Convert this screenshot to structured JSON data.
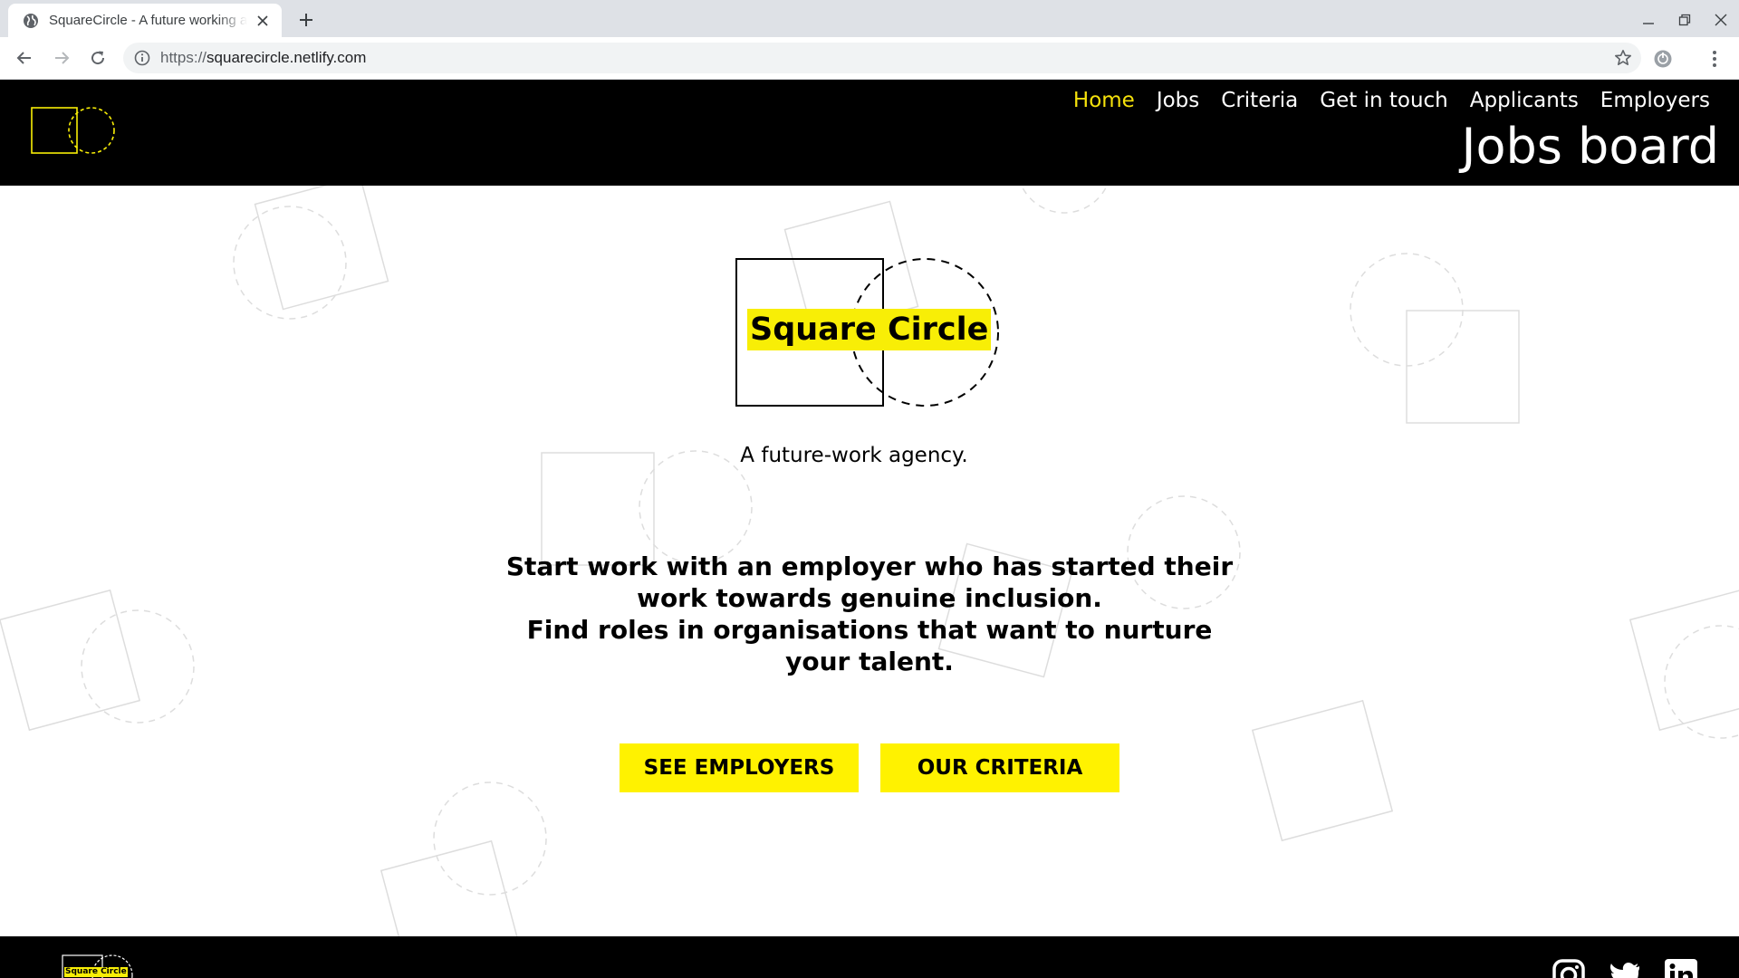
{
  "browser": {
    "tab_title": "SquareCircle - A future working agency",
    "url_scheme": "https://",
    "url_host": "squarecircle.netlify.com"
  },
  "site": {
    "nav": [
      {
        "label": "Home",
        "active": true
      },
      {
        "label": "Jobs",
        "active": false
      },
      {
        "label": "Criteria",
        "active": false
      },
      {
        "label": "Get in touch",
        "active": false
      },
      {
        "label": "Applicants",
        "active": false
      },
      {
        "label": "Employers",
        "active": false
      }
    ],
    "page_title": "Jobs board",
    "logo_text": "Square Circle",
    "tagline": "A future-work agency.",
    "intro_line1": "Start work with an employer who has started their work towards genuine inclusion.",
    "intro_line2": "Find roles in organisations that want to nurture your talent.",
    "cta_primary": "SEE EMPLOYERS",
    "cta_secondary": "OUR CRITERIA",
    "footer_logo_text": "Square Circle",
    "social": [
      "instagram-icon",
      "twitter-icon",
      "linkedin-icon"
    ]
  },
  "colors": {
    "header_bg": "#000000",
    "accent_yellow": "#fff200",
    "active_nav": "#f5e10b",
    "chrome_tabstrip": "#dee1e6"
  }
}
